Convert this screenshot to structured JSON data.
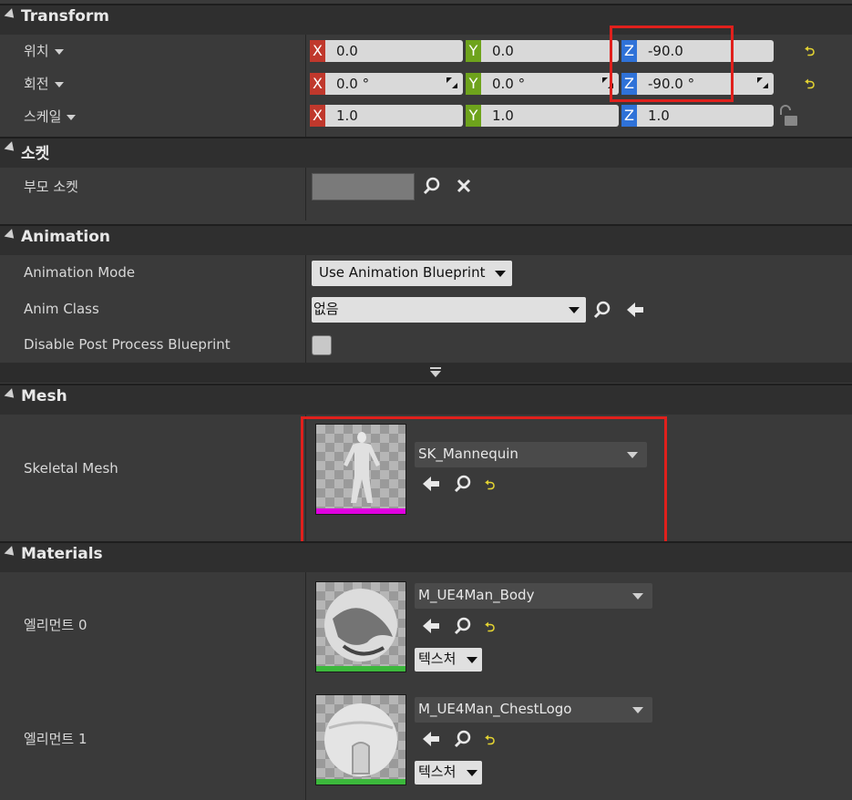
{
  "transform": {
    "title": "Transform",
    "location": {
      "label": "위치",
      "x": "0.0",
      "y": "0.0",
      "z": "-90.0"
    },
    "rotation": {
      "label": "회전",
      "x": "0.0 °",
      "y": "0.0 °",
      "z": "-90.0 °"
    },
    "scale": {
      "label": "스케일",
      "x": "1.0",
      "y": "1.0",
      "z": "1.0"
    },
    "axes": {
      "x": "X",
      "y": "Y",
      "z": "Z"
    }
  },
  "socket": {
    "title": "소켓",
    "parent_socket_label": "부모 소켓"
  },
  "animation": {
    "title": "Animation",
    "mode_label": "Animation Mode",
    "mode_value": "Use Animation Blueprint",
    "class_label": "Anim Class",
    "class_value": "없음",
    "disable_pp_label": "Disable Post Process Blueprint"
  },
  "mesh": {
    "title": "Mesh",
    "skeletal_label": "Skeletal Mesh",
    "skeletal_value": "SK_Mannequin"
  },
  "materials": {
    "title": "Materials",
    "elements": [
      {
        "label": "엘리먼트 0",
        "value": "M_UE4Man_Body",
        "texture_button": "텍스처"
      },
      {
        "label": "엘리먼트 1",
        "value": "M_UE4Man_ChestLogo",
        "texture_button": "텍스처"
      }
    ]
  },
  "colors": {
    "highlight": "#e0201c",
    "mesh_bar": "#e000e0",
    "material_bar": "#3cb83c"
  }
}
